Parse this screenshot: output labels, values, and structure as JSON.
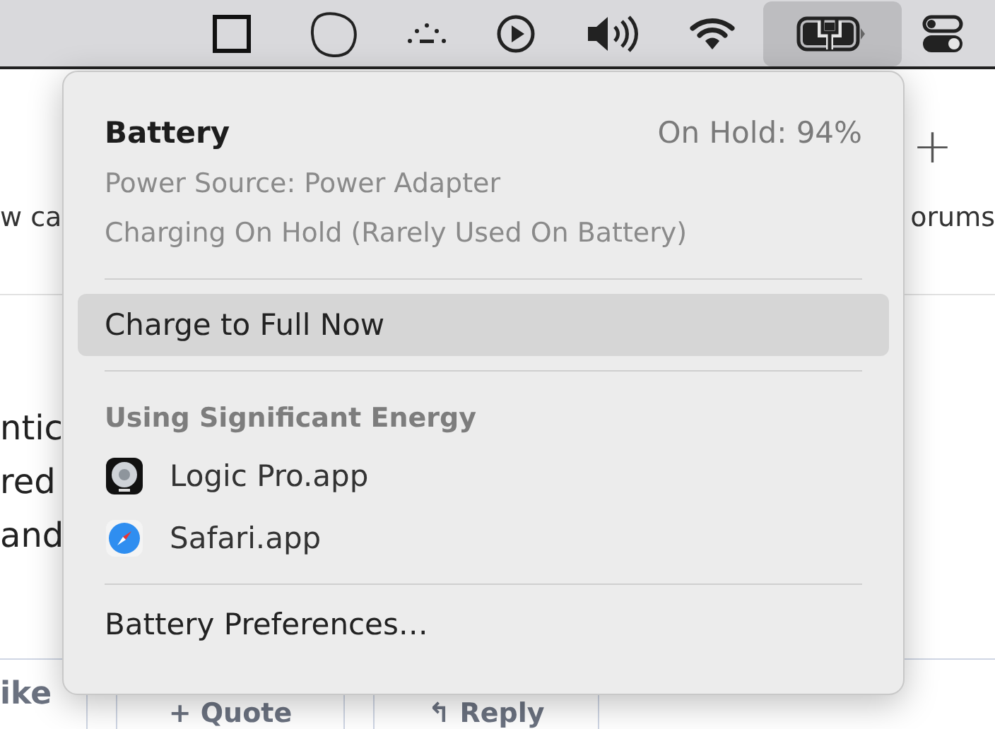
{
  "menubar": {
    "icons": [
      {
        "kind": "square",
        "selected": false
      },
      {
        "kind": "blob",
        "selected": false
      },
      {
        "kind": "dots",
        "selected": false
      },
      {
        "kind": "play",
        "selected": false
      },
      {
        "kind": "volume",
        "selected": false
      },
      {
        "kind": "wifi",
        "selected": false
      },
      {
        "kind": "battery",
        "selected": true
      },
      {
        "kind": "toggles",
        "selected": false
      }
    ]
  },
  "background": {
    "add_symbol": "+",
    "nav_left": "w ca",
    "nav_right": "orums",
    "body_lines": [
      "ntic",
      "red",
      "and"
    ],
    "like": "ike",
    "buttons": [
      {
        "label": "+ Quote"
      },
      {
        "label": "↰ Reply"
      }
    ]
  },
  "battery_menu": {
    "title": "Battery",
    "status": "On Hold: 94%",
    "info": [
      "Power Source: Power Adapter",
      "Charging On Hold (Rarely Used On Battery)"
    ],
    "action": {
      "label": "Charge to Full Now",
      "selected": true
    },
    "section": "Using Significant Energy",
    "apps": [
      {
        "name": "Logic Pro.app",
        "kind": "logic"
      },
      {
        "name": "Safari.app",
        "kind": "safari"
      }
    ],
    "footer": "Battery Preferences…"
  }
}
